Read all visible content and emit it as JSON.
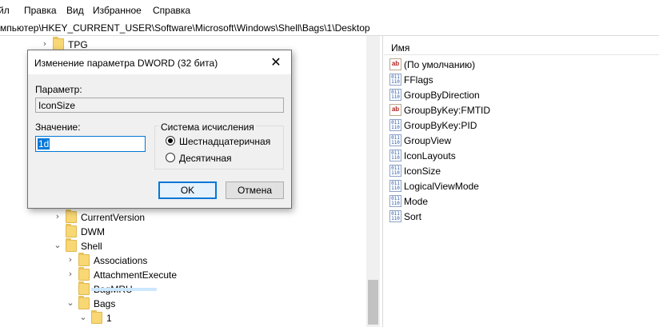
{
  "menu": {
    "items": [
      "йл",
      "Правка",
      "Вид",
      "Избранное",
      "Справка"
    ]
  },
  "address": {
    "path": "мпьютер\\HKEY_CURRENT_USER\\Software\\Microsoft\\Windows\\Shell\\Bags\\1\\Desktop"
  },
  "tree": {
    "items": [
      {
        "label": "TPG",
        "expand": "collapsed"
      },
      {
        "label": "CurrentVersion",
        "expand": "collapsed"
      },
      {
        "label": "DWM",
        "expand": "none"
      },
      {
        "label": "Shell",
        "expand": "expanded"
      },
      {
        "label": "Associations",
        "expand": "collapsed"
      },
      {
        "label": "AttachmentExecute",
        "expand": "collapsed"
      },
      {
        "label": "BagMRU",
        "expand": "none"
      },
      {
        "label": "Bags",
        "expand": "expanded"
      },
      {
        "label": "1",
        "expand": "expanded"
      }
    ]
  },
  "values": {
    "column_name": "Имя",
    "rows": [
      {
        "name": "(По умолчанию)",
        "type": "string"
      },
      {
        "name": "FFlags",
        "type": "dword"
      },
      {
        "name": "GroupByDirection",
        "type": "dword"
      },
      {
        "name": "GroupByKey:FMTID",
        "type": "string"
      },
      {
        "name": "GroupByKey:PID",
        "type": "dword"
      },
      {
        "name": "GroupView",
        "type": "dword"
      },
      {
        "name": "IconLayouts",
        "type": "dword"
      },
      {
        "name": "IconSize",
        "type": "dword"
      },
      {
        "name": "LogicalViewMode",
        "type": "dword"
      },
      {
        "name": "Mode",
        "type": "dword"
      },
      {
        "name": "Sort",
        "type": "dword"
      }
    ]
  },
  "dialog": {
    "title": "Изменение параметра DWORD (32 бита)",
    "param_label": "Параметр:",
    "param_value": "IconSize",
    "value_label": "Значение:",
    "value": "1d",
    "base_group_title": "Система исчисления",
    "base_options": [
      "Шестнадцатеричная",
      "Десятичная"
    ],
    "base_selected": "Шестнадцатеричная",
    "ok_label": "OK",
    "cancel_label": "Отмена"
  },
  "icons": {
    "dword_icon": "dword-value-icon",
    "string_icon": "string-value-icon",
    "folder_icon": "folder-icon",
    "close_icon": "close-icon"
  },
  "colors": {
    "selection": "#0078d7",
    "folder": "#f8d775"
  }
}
